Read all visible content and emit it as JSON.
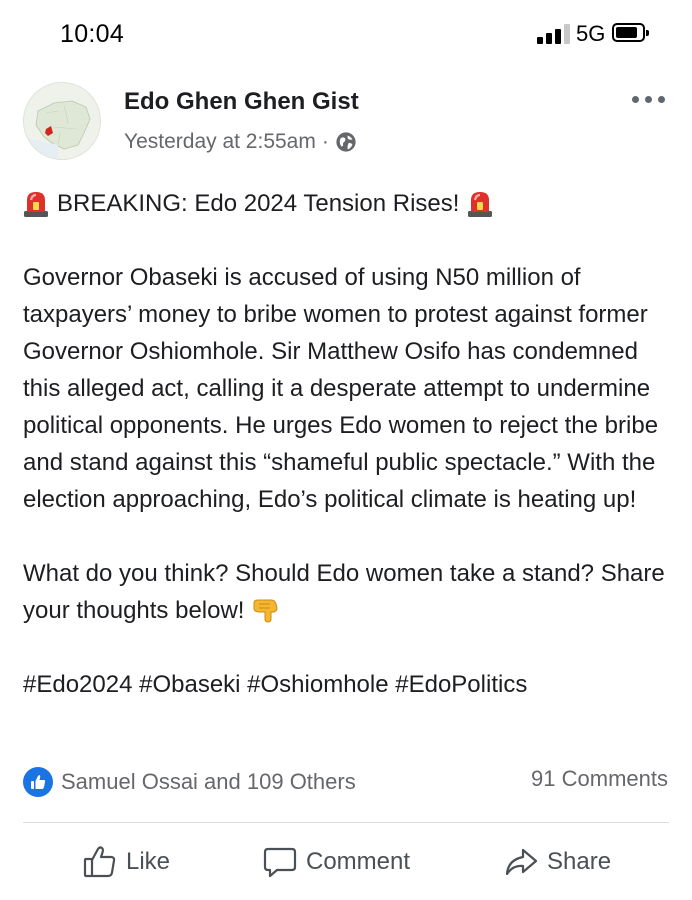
{
  "status_bar": {
    "time": "10:04",
    "network": "5G",
    "icons": [
      "signal-icon",
      "battery-icon"
    ]
  },
  "post": {
    "author": "Edo Ghen Ghen Gist",
    "timestamp": "Yesterday at 2:55am",
    "separator": "·",
    "privacy_icon": "globe-icon",
    "headline": "BREAKING: Edo 2024 Tension Rises!",
    "headline_icon": "siren-emoji",
    "paragraphs": [
      "Governor Obaseki is accused of using N50 million of taxpayers’ money to bribe women to protest against former Governor Oshiomhole. Sir Matthew Osifo has condemned this alleged act, calling it a desperate attempt to undermine political opponents. He urges Edo women to reject the bribe and stand against this “shameful public spectacle.” With the election approaching, Edo’s political climate is heating up!",
      "What do you think? Should Edo women take a stand? Share your thoughts below!"
    ],
    "cta_icon": "pointing-down-emoji",
    "hashtags": "#Edo2024 #Obaseki #Oshiomhole #EdoPolitics"
  },
  "engagement": {
    "reactions_text": "Samuel Ossai and 109 Others",
    "comments_text": "91 Comments"
  },
  "actions": {
    "like": "Like",
    "comment": "Comment",
    "share": "Share"
  },
  "colors": {
    "primary_text": "#1c1e21",
    "secondary_text": "#65676b",
    "like_blue": "#1b74e4",
    "divider": "#dadde1"
  }
}
